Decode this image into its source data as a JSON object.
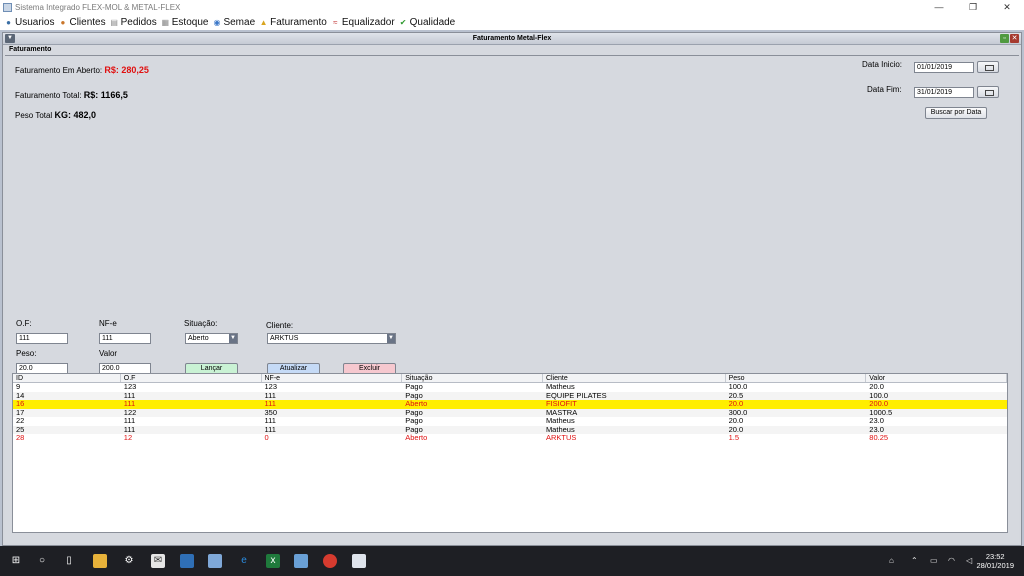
{
  "window": {
    "title": "Sistema Integrado FLEX-MOL & METAL-FLEX",
    "min": "—",
    "max": "❐",
    "close": "✕"
  },
  "menu": [
    {
      "label": "Usuarios",
      "icon": "users-icon"
    },
    {
      "label": "Clientes",
      "icon": "clients-icon"
    },
    {
      "label": "Pedidos",
      "icon": "orders-icon"
    },
    {
      "label": "Estoque",
      "icon": "stock-icon"
    },
    {
      "label": "Semae",
      "icon": "water-icon"
    },
    {
      "label": "Faturamento",
      "icon": "billing-icon"
    },
    {
      "label": "Equalizador",
      "icon": "equalizer-icon"
    },
    {
      "label": "Qualidade",
      "icon": "check-icon"
    }
  ],
  "internal_frame": {
    "title": "Faturamento Metal-Flex",
    "panel_label": "Faturamento"
  },
  "summary": {
    "aberto_label": "Faturamento Em Aberto:",
    "aberto_value": "R$: 280,25",
    "total_label": "Faturamento Total:",
    "total_value": "R$: 1166,5",
    "peso_label": "Peso Total",
    "peso_value": "KG: 482,0"
  },
  "date_filter": {
    "inicio_label": "Data Inicio:",
    "inicio_value": "01/01/2019",
    "fim_label": "Data Fim:",
    "fim_value": "31/01/2019",
    "buscar_label": "Buscar por Data"
  },
  "form": {
    "of_label": "O.F:",
    "of_value": "111",
    "nfe_label": "NF-e",
    "nfe_value": "111",
    "situacao_label": "Situação:",
    "situacao_value": "Aberto",
    "cliente_label": "Cliente:",
    "cliente_value": "ARKTUS",
    "peso_label": "Peso:",
    "peso_value": "20.0",
    "valor_label": "Valor",
    "valor_value": "200.0",
    "lancar_label": "Lançar",
    "atualizar_label": "Atualizar",
    "excluir_label": "Excluir"
  },
  "table": {
    "columns": [
      "ID",
      "O.F",
      "NF-e",
      "Situação",
      "Cliente",
      "Peso",
      "Valor"
    ],
    "rows": [
      {
        "cells": [
          "9",
          "123",
          "123",
          "Pago",
          "Matheus",
          "100.0",
          "20.0"
        ],
        "style": ""
      },
      {
        "cells": [
          "14",
          "111",
          "111",
          "Pago",
          "EQUIPE PILATES",
          "20.5",
          "100.0"
        ],
        "style": "alt"
      },
      {
        "cells": [
          "16",
          "111",
          "111",
          "Aberto",
          "FISIOFIT",
          "20.0",
          "200.0"
        ],
        "style": "sel"
      },
      {
        "cells": [
          "17",
          "122",
          "350",
          "Pago",
          "MASTRA",
          "300.0",
          "1000.5"
        ],
        "style": "alt"
      },
      {
        "cells": [
          "22",
          "111",
          "111",
          "Pago",
          "Matheus",
          "20.0",
          "23.0"
        ],
        "style": ""
      },
      {
        "cells": [
          "25",
          "111",
          "111",
          "Pago",
          "Matheus",
          "20.0",
          "23.0"
        ],
        "style": "alt"
      },
      {
        "cells": [
          "28",
          "12",
          "0",
          "Aberto",
          "ARKTUS",
          "1.5",
          "80.25"
        ],
        "style": "red"
      }
    ]
  },
  "taskbar": {
    "time": "23:52",
    "date": "28/01/2019"
  }
}
